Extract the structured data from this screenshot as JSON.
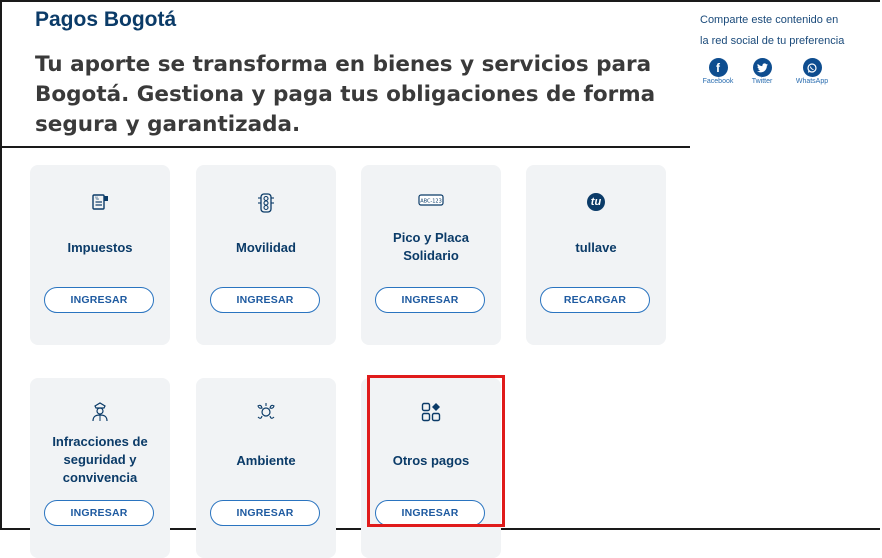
{
  "header": {
    "title": "Pagos Bogotá",
    "lead": "Tu aporte se transforma en bienes y servicios para Bogotá. Gestiona y paga tus obligaciones de forma segura y garantizada."
  },
  "share": {
    "text_line1": "Comparte este contenido en",
    "text_line2": "la red social de tu preferencia",
    "networks": [
      {
        "label": "Facebook",
        "icon": "facebook-icon"
      },
      {
        "label": "Twitter",
        "icon": "twitter-icon"
      },
      {
        "label": "WhatsApp",
        "icon": "whatsapp-icon"
      }
    ]
  },
  "cards": [
    {
      "name": "Impuestos",
      "button": "INGRESAR",
      "icon": "tax-document-icon"
    },
    {
      "name": "Movilidad",
      "button": "INGRESAR",
      "icon": "traffic-light-icon"
    },
    {
      "name": "Pico y Placa Solidario",
      "button": "INGRESAR",
      "icon": "license-plate-icon",
      "plate_text": "ABC-123"
    },
    {
      "name": "tullave",
      "button": "RECARGAR",
      "icon": "tullave-logo-icon",
      "logo_text": "tu"
    },
    {
      "name": "Infracciones de seguridad y convivencia",
      "button": "INGRESAR",
      "icon": "police-officer-icon"
    },
    {
      "name": "Ambiente",
      "button": "INGRESAR",
      "icon": "environment-icon"
    },
    {
      "name": "Otros pagos",
      "button": "INGRESAR",
      "icon": "grid-apps-icon"
    }
  ],
  "colors": {
    "primary": "#0b3b68",
    "button_border": "#2a74c0",
    "card_bg": "#f1f3f5",
    "highlight": "#e01b1b"
  }
}
